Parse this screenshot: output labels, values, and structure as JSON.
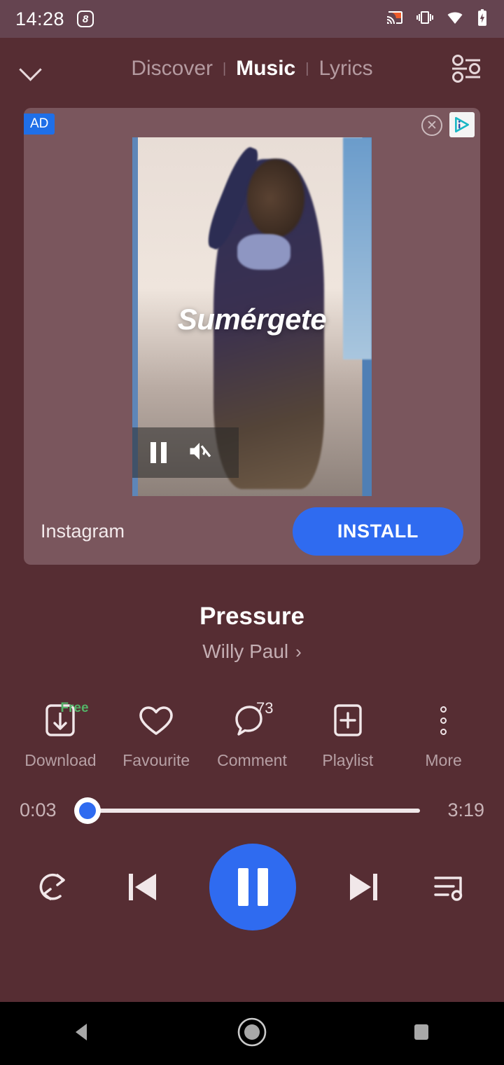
{
  "status_bar": {
    "time": "14:28",
    "app_badge": "8",
    "icons": [
      "cast-icon",
      "vibrate-icon",
      "wifi-icon",
      "battery-charging-icon"
    ],
    "background": "#654450"
  },
  "top_nav": {
    "collapse_icon": "chevron-down-icon",
    "tabs": [
      {
        "label": "Discover",
        "active": false
      },
      {
        "label": "Music",
        "active": true
      },
      {
        "label": "Lyrics",
        "active": false
      }
    ],
    "separator": "|",
    "equalizer_icon": "equalizer-icon"
  },
  "ad": {
    "badge": "AD",
    "close_icon": "close-icon",
    "adchoices_icon": "adchoices-icon",
    "video_caption": "Sumérgete",
    "video_pause_icon": "pause-icon",
    "video_mute_icon": "volume-off-icon",
    "app_name": "Instagram",
    "cta_label": "INSTALL",
    "cta_color": "#2f6bf0",
    "card_background": "#7a565d"
  },
  "track": {
    "title": "Pressure",
    "artist": "Willy Paul",
    "artist_chevron": "›"
  },
  "actions": [
    {
      "label": "Download",
      "icon": "download-icon",
      "badge": "Free",
      "badge_color": "#53b267"
    },
    {
      "label": "Favourite",
      "icon": "heart-icon",
      "badge": ""
    },
    {
      "label": "Comment",
      "icon": "comment-icon",
      "badge": "73"
    },
    {
      "label": "Playlist",
      "icon": "add-to-playlist-icon",
      "badge": ""
    },
    {
      "label": "More",
      "icon": "more-vertical-icon",
      "badge": ""
    }
  ],
  "seek": {
    "elapsed": "0:03",
    "duration": "3:19",
    "progress_percent": 1,
    "thumb_color": "#2f6bf0"
  },
  "controls": {
    "repeat_icon": "repeat-icon",
    "previous_icon": "skip-previous-icon",
    "play_pause_icon": "pause-icon",
    "next_icon": "skip-next-icon",
    "queue_icon": "queue-music-icon",
    "accent": "#2f6bf0"
  },
  "android_nav": {
    "back_icon": "back-triangle-icon",
    "home_icon": "home-circle-icon",
    "recents_icon": "recents-square-icon"
  },
  "theme": {
    "background": "#562d33",
    "text_primary": "#ffffff",
    "text_secondary": "#b7a0a5"
  }
}
